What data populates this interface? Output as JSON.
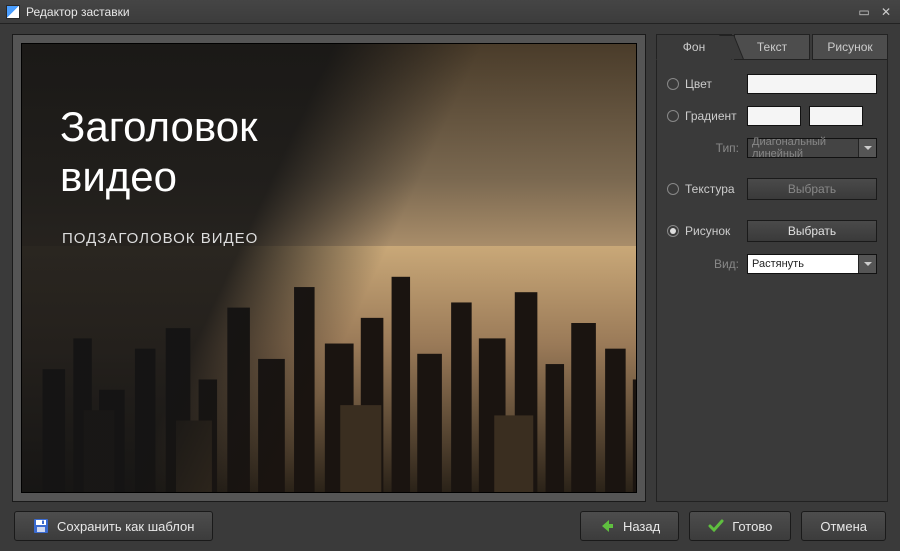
{
  "window": {
    "title": "Редактор заставки"
  },
  "preview": {
    "title_line1": "Заголовок",
    "title_line2": "видео",
    "subtitle": "ПОДЗАГОЛОВОК ВИДЕО"
  },
  "tabs": {
    "bg": "Фон",
    "text": "Текст",
    "image": "Рисунок"
  },
  "panel": {
    "color_label": "Цвет",
    "gradient_label": "Градиент",
    "type_label": "Тип:",
    "type_value": "Диагональный линейный",
    "texture_label": "Текстура",
    "texture_btn": "Выбрать",
    "image_label": "Рисунок",
    "image_btn": "Выбрать",
    "fit_label": "Вид:",
    "fit_value": "Растянуть",
    "selected_radio": "image"
  },
  "footer": {
    "save_template": "Сохранить как шаблон",
    "back": "Назад",
    "done": "Готово",
    "cancel": "Отмена"
  },
  "colors": {
    "accent_green": "#5fbf3f",
    "accent_arrow": "#4fbf2f"
  }
}
